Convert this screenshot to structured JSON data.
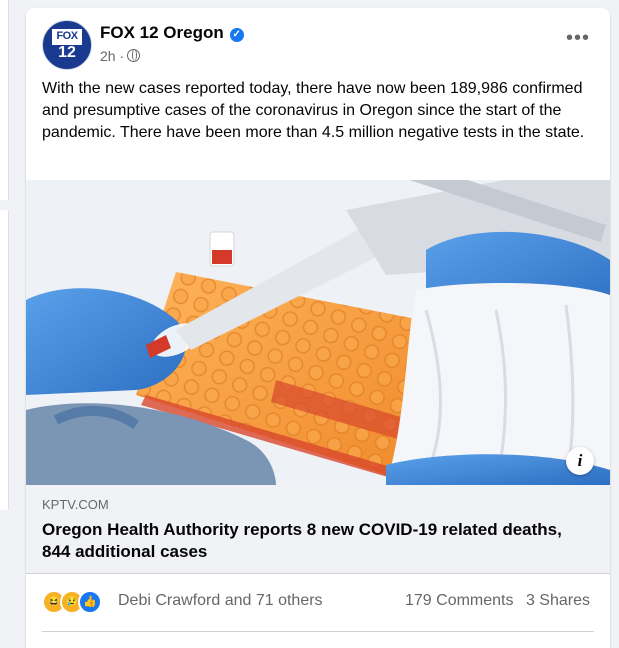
{
  "post": {
    "page_name": "FOX 12 Oregon",
    "avatar_top": "FOX",
    "avatar_bottom": "12",
    "time": "2h",
    "separator": "·",
    "more_label": "•••",
    "text": "With the new cases reported today, there have now been 189,986 confirmed and presumptive cases of the coronavirus in Oregon since the start of the pandemic. There have been more than 4.5 million negative tests in the state."
  },
  "link": {
    "domain": "KPTV.COM",
    "title": "Oregon Health Authority reports 8 new COVID-19 related deaths, 844 additional cases",
    "info_label": "i"
  },
  "engagement": {
    "reactors": "Debi Crawford and 71 others",
    "comments": "179 Comments",
    "shares": "3 Shares",
    "reaction_icons": [
      "haha-icon",
      "sad-icon",
      "like-icon"
    ]
  },
  "colors": {
    "accent": "#1877f2",
    "secondary_text": "#65676b",
    "glove": "#3f86d8",
    "rack": "#f59a3c"
  }
}
